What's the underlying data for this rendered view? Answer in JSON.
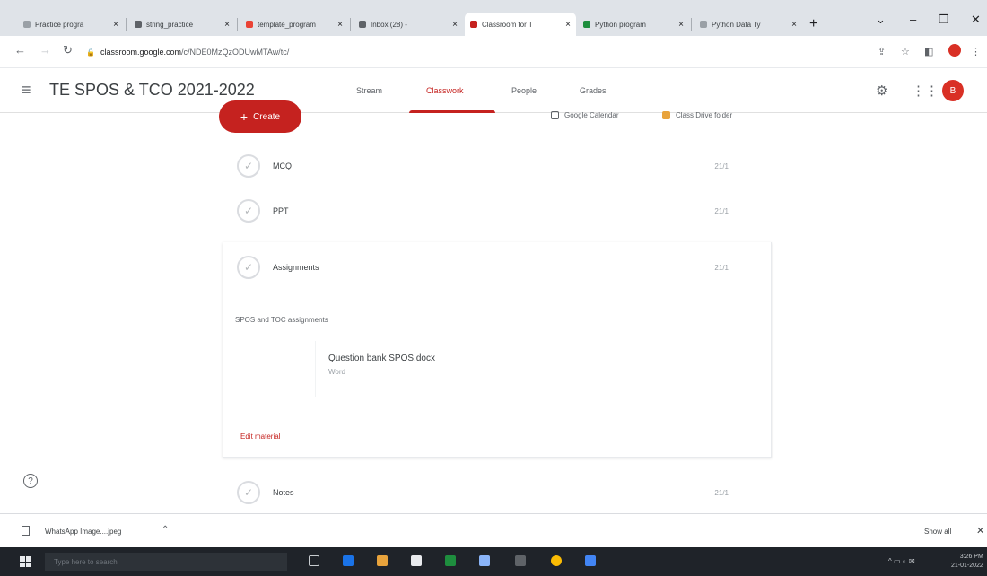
{
  "browser": {
    "tabs": [
      {
        "label": "Practice progra",
        "color": "#9aa0a6"
      },
      {
        "label": "string_practice",
        "color": "#5f6368"
      },
      {
        "label": "template_program",
        "color": "#ea4335"
      },
      {
        "label": "Inbox (28) - ",
        "color": "#5f6368"
      },
      {
        "label": "Classroom for T",
        "color": "#c5221f"
      },
      {
        "label": "Python program",
        "color": "#1e8e3e"
      },
      {
        "label": "Python Data Ty",
        "color": "#9aa0a6"
      }
    ],
    "new_tab_label": "+",
    "url_host": "classroom.google.com",
    "url_path": "/c/NDE0MzQzODUwMTAw/tc/"
  },
  "classroom": {
    "course_title": "TE SPOS & TCO 2021-2022",
    "nav_tabs": [
      "Stream",
      "Classwork",
      "People",
      "Grades"
    ],
    "avatar_letter": "B",
    "create_label": "Create",
    "calendar_link": "Google Calendar",
    "drive_link": "Class Drive folder",
    "topics": [
      {
        "label": "MCQ",
        "date": "21/1"
      },
      {
        "label": "PPT",
        "date": "21/1"
      },
      {
        "label": "Assignments",
        "date": "21/1"
      },
      {
        "label": "Notes",
        "date": "21/1"
      }
    ],
    "description": "SPOS and TOC assignments",
    "attachment": {
      "title": "Question bank SPOS.docx",
      "subtitle": "Word"
    },
    "edit_label": "Edit material"
  },
  "downloads": {
    "file_name": "WhatsApp Image....jpeg",
    "show_all": "Show all"
  },
  "taskbar": {
    "search_placeholder": "Type here to search",
    "clock_time": "3:26 PM",
    "clock_date": "21-01-2022"
  },
  "colors": {
    "accent": "#c5221f",
    "taskbar": "#1f2329"
  }
}
